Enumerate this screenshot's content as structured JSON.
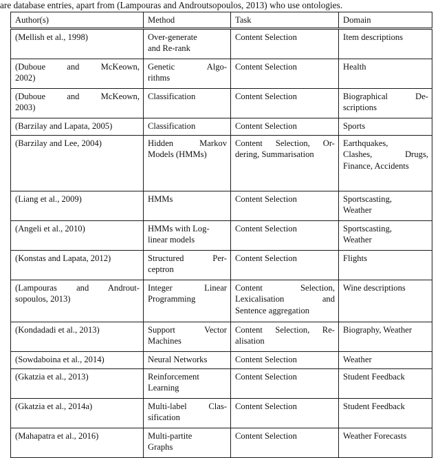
{
  "document": {
    "lead_text": "are database entries, apart from (Lampouras and Androutsopoulos, 2013) who use ontologies."
  },
  "table": {
    "columns": [
      "Author(s)",
      "Method",
      "Task",
      "Domain"
    ],
    "rows": [
      {
        "author": "(Mellish et al., 1998)",
        "method": "Over-generate and Re-rank",
        "task": "Content Selection",
        "domain": "Item descriptions",
        "height_class": "h2"
      },
      {
        "author": "(Duboue and McKeown, 2002)",
        "method": "Genetic Algorithms",
        "task": "Content Selection",
        "domain": "Health",
        "height_class": "h2"
      },
      {
        "author": "(Duboue and McKeown, 2003)",
        "method": "Classification",
        "task": "Content Selection",
        "domain": "Biographical Descriptions",
        "height_class": "h2"
      },
      {
        "author": "(Barzilay and Lapata, 2005)",
        "method": "Classification",
        "task": "Content Selection",
        "domain": "Sports",
        "height_class": "h1"
      },
      {
        "author": "(Barzilay and Lee, 2004)",
        "method": "Hidden Markov Models (HMMs)",
        "task": "Content Selection, Ordering, Summarisation",
        "domain": "Earthquakes, Clashes, Drugs, Finance, Accidents",
        "height_class": "h4"
      },
      {
        "author": "(Liang et al., 2009)",
        "method": "HMMs",
        "task": "Content Selection",
        "domain": "Sportscasting, Weather",
        "height_class": "h2"
      },
      {
        "author": "(Angeli et al., 2010)",
        "method": "HMMs with Log-linear models",
        "task": "Content Selection",
        "domain": "Sportscasting, Weather",
        "height_class": "h2"
      },
      {
        "author": "(Konstas and Lapata, 2012)",
        "method": "Structured Perceptron",
        "task": "Content Selection",
        "domain": "Flights",
        "height_class": "h2"
      },
      {
        "author": "(Lampouras and Androutsopoulos, 2013)",
        "method": "Integer Linear Programming",
        "task": "Content Selection, Lexicalisation and Sentence aggregation",
        "domain": "Wine descriptions",
        "height_class": "h3"
      },
      {
        "author": "(Kondadadi et al., 2013)",
        "method": "Support Vector Machines",
        "task": "Content Selection, Realisation",
        "domain": "Biography, Weather",
        "height_class": "h2"
      },
      {
        "author": "(Sowdaboina et al., 2014)",
        "method": "Neural Networks",
        "task": "Content Selection",
        "domain": "Weather",
        "height_class": "h1"
      },
      {
        "author": "(Gkatzia et al., 2013)",
        "method": "Reinforcement Learning",
        "task": "Content Selection",
        "domain": "Student Feedback",
        "height_class": "h2"
      },
      {
        "author": "(Gkatzia et al., 2014a)",
        "method": "Multi-label Classification",
        "task": "Content Selection",
        "domain": "Student Feedback",
        "height_class": "h2"
      },
      {
        "author": "(Mahapatra et al., 2016)",
        "method": "Multi-partite Graphs",
        "task": "Content Selection",
        "domain": "Weather Forecasts",
        "height_class": "h2"
      }
    ],
    "rendered_lines": [
      {
        "author": [
          "(Mellish et al., 1998)"
        ],
        "method": [
          "Over-generate",
          "and Re-rank"
        ],
        "task": [
          "Content Selection"
        ],
        "domain": [
          "Item descriptions"
        ],
        "author_justify": [
          false
        ],
        "method_justify": [
          false,
          false
        ],
        "task_justify": [
          false
        ],
        "domain_justify": [
          false
        ]
      },
      {
        "author": [
          "(Duboue and McKeown,",
          "2002)"
        ],
        "method": [
          "Genetic Algo-",
          "rithms"
        ],
        "task": [
          "Content Selection"
        ],
        "domain": [
          "Health"
        ],
        "author_justify": [
          true,
          false
        ],
        "method_justify": [
          true,
          false
        ],
        "task_justify": [
          false
        ],
        "domain_justify": [
          false
        ]
      },
      {
        "author": [
          "(Duboue and McKeown,",
          "2003)"
        ],
        "method": [
          "Classification"
        ],
        "task": [
          "Content Selection"
        ],
        "domain": [
          "Biographical De-",
          "scriptions"
        ],
        "author_justify": [
          true,
          false
        ],
        "method_justify": [
          false
        ],
        "task_justify": [
          false
        ],
        "domain_justify": [
          true,
          false
        ]
      },
      {
        "author": [
          "(Barzilay and Lapata, 2005)"
        ],
        "method": [
          "Classification"
        ],
        "task": [
          "Content Selection"
        ],
        "domain": [
          "Sports"
        ],
        "author_justify": [
          false
        ],
        "method_justify": [
          false
        ],
        "task_justify": [
          false
        ],
        "domain_justify": [
          false
        ]
      },
      {
        "author": [
          "(Barzilay and Lee, 2004)"
        ],
        "method": [
          "Hidden Markov",
          "Models (HMMs)"
        ],
        "task": [
          "Content Selection, Or-",
          "dering, Summarisation"
        ],
        "domain": [
          "Earthquakes,",
          "Clashes, Drugs,",
          "Finance, Accidents"
        ],
        "author_justify": [
          false
        ],
        "method_justify": [
          true,
          false
        ],
        "task_justify": [
          true,
          false
        ],
        "domain_justify": [
          false,
          true,
          false
        ]
      },
      {
        "author": [
          "(Liang et al., 2009)"
        ],
        "method": [
          "HMMs"
        ],
        "task": [
          "Content Selection"
        ],
        "domain": [
          "Sportscasting,",
          "Weather"
        ],
        "author_justify": [
          false
        ],
        "method_justify": [
          false
        ],
        "task_justify": [
          false
        ],
        "domain_justify": [
          false,
          false
        ]
      },
      {
        "author": [
          "(Angeli et al., 2010)"
        ],
        "method": [
          "HMMs with Log-",
          "linear models"
        ],
        "task": [
          "Content Selection"
        ],
        "domain": [
          "Sportscasting,",
          "Weather"
        ],
        "author_justify": [
          false
        ],
        "method_justify": [
          false,
          false
        ],
        "task_justify": [
          false
        ],
        "domain_justify": [
          false,
          false
        ]
      },
      {
        "author": [
          "(Konstas and Lapata, 2012)"
        ],
        "method": [
          "Structured Per-",
          "ceptron"
        ],
        "task": [
          "Content Selection"
        ],
        "domain": [
          "Flights"
        ],
        "author_justify": [
          false
        ],
        "method_justify": [
          true,
          false
        ],
        "task_justify": [
          false
        ],
        "domain_justify": [
          false
        ]
      },
      {
        "author": [
          "(Lampouras and Androut-",
          "sopoulos, 2013)"
        ],
        "method": [
          "Integer Linear",
          "Programming"
        ],
        "task": [
          "Content Selection,",
          "Lexicalisation and",
          "Sentence aggregation"
        ],
        "domain": [
          "Wine descriptions"
        ],
        "author_justify": [
          true,
          false
        ],
        "method_justify": [
          true,
          false
        ],
        "task_justify": [
          true,
          true,
          false
        ],
        "domain_justify": [
          false
        ]
      },
      {
        "author": [
          "(Kondadadi et al., 2013)"
        ],
        "method": [
          "Support Vector",
          "Machines"
        ],
        "task": [
          "Content Selection, Re-",
          "alisation"
        ],
        "domain": [
          "Biography, Weather"
        ],
        "author_justify": [
          false
        ],
        "method_justify": [
          true,
          false
        ],
        "task_justify": [
          true,
          false
        ],
        "domain_justify": [
          false
        ]
      },
      {
        "author": [
          "(Sowdaboina et al., 2014)"
        ],
        "method": [
          "Neural Networks"
        ],
        "task": [
          "Content Selection"
        ],
        "domain": [
          "Weather"
        ],
        "author_justify": [
          false
        ],
        "method_justify": [
          false
        ],
        "task_justify": [
          false
        ],
        "domain_justify": [
          false
        ]
      },
      {
        "author": [
          "(Gkatzia et al., 2013)"
        ],
        "method": [
          "Reinforcement",
          "Learning"
        ],
        "task": [
          "Content Selection"
        ],
        "domain": [
          "Student Feedback"
        ],
        "author_justify": [
          false
        ],
        "method_justify": [
          false,
          false
        ],
        "task_justify": [
          false
        ],
        "domain_justify": [
          false
        ]
      },
      {
        "author": [
          "(Gkatzia et al., 2014a)"
        ],
        "method": [
          "Multi-label Clas-",
          "sification"
        ],
        "task": [
          "Content Selection"
        ],
        "domain": [
          "Student Feedback"
        ],
        "author_justify": [
          false
        ],
        "method_justify": [
          true,
          false
        ],
        "task_justify": [
          false
        ],
        "domain_justify": [
          false
        ]
      },
      {
        "author": [
          "(Mahapatra et al., 2016)"
        ],
        "method": [
          "Multi-partite",
          "Graphs"
        ],
        "task": [
          "Content Selection"
        ],
        "domain": [
          "Weather Forecasts"
        ],
        "author_justify": [
          false
        ],
        "method_justify": [
          false,
          false
        ],
        "task_justify": [
          false
        ],
        "domain_justify": [
          false
        ]
      }
    ]
  }
}
